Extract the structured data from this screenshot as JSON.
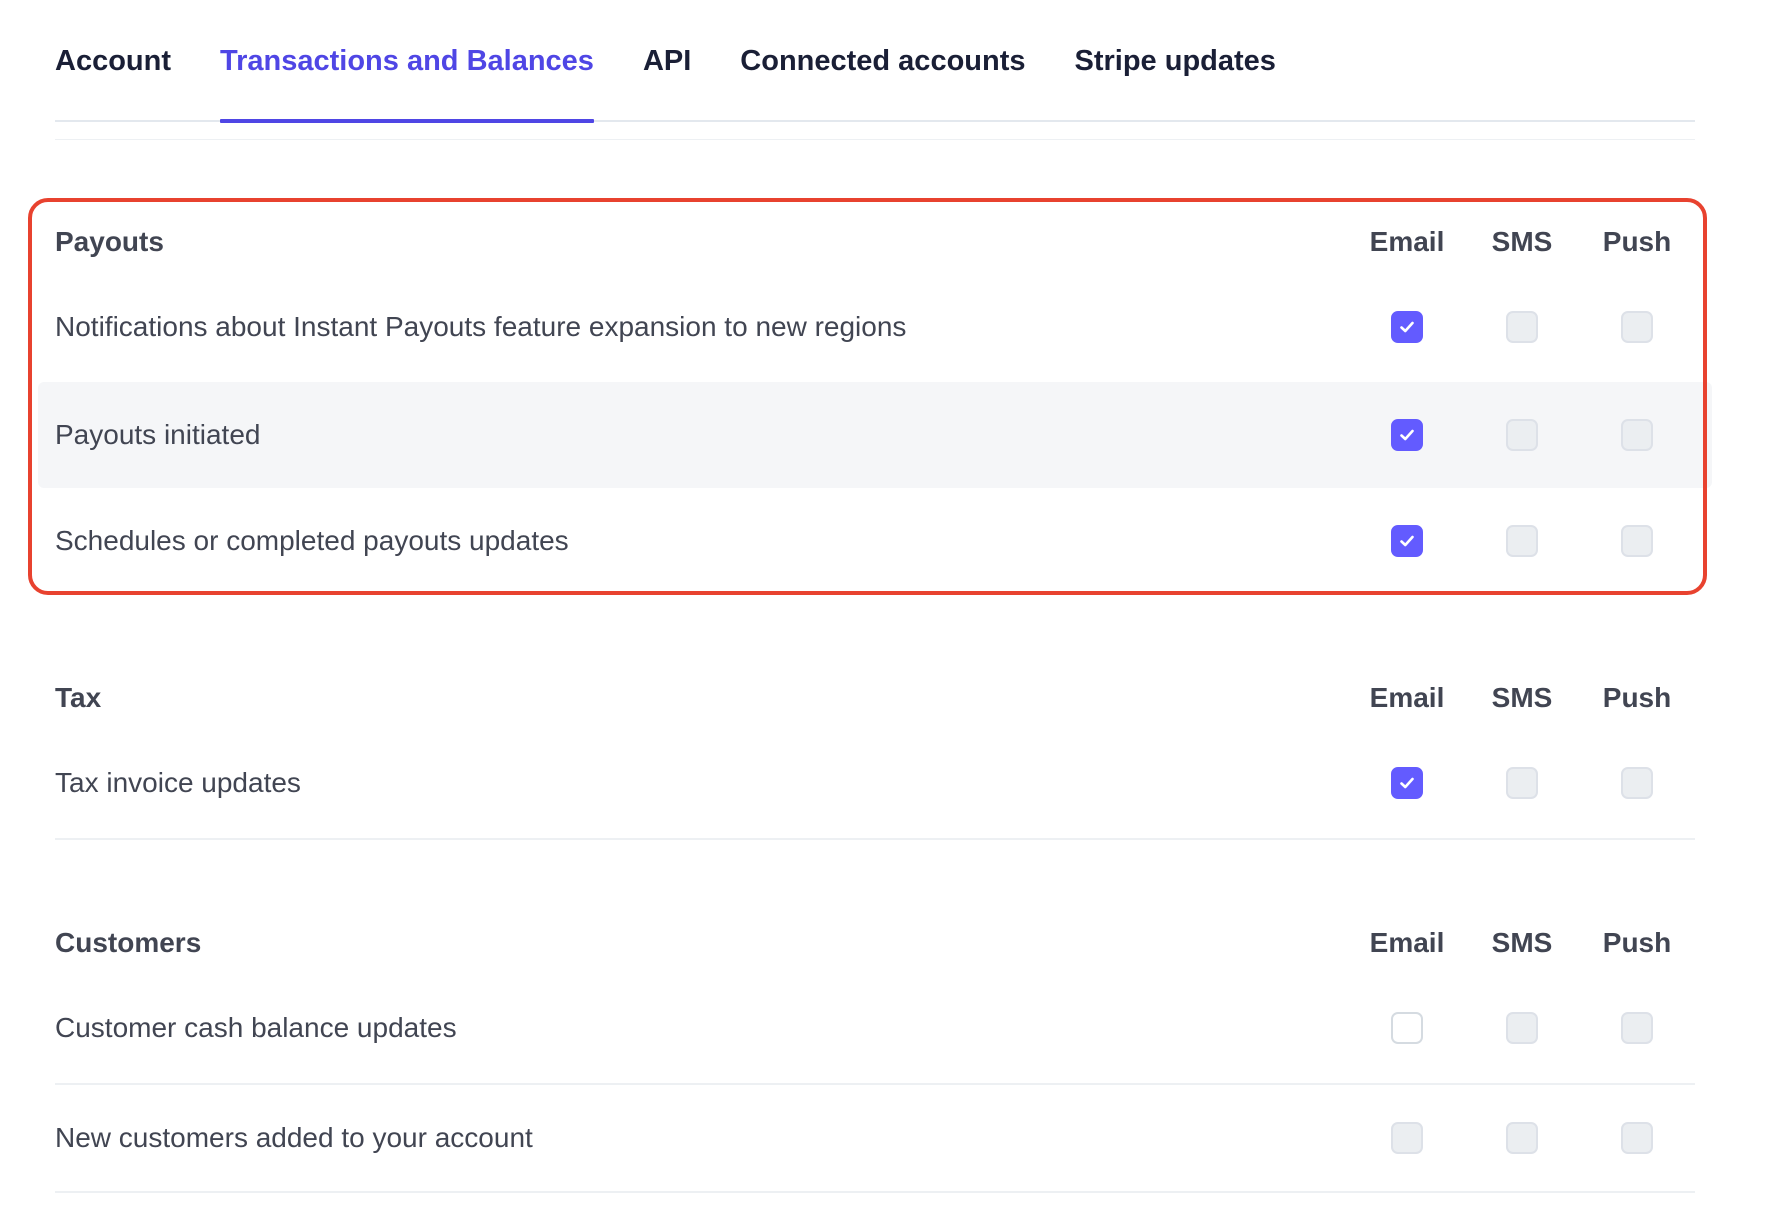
{
  "tabs": [
    {
      "label": "Account",
      "active": false
    },
    {
      "label": "Transactions and Balances",
      "active": true
    },
    {
      "label": "API",
      "active": false
    },
    {
      "label": "Connected accounts",
      "active": false
    },
    {
      "label": "Stripe updates",
      "active": false
    }
  ],
  "columns": {
    "email": "Email",
    "sms": "SMS",
    "push": "Push"
  },
  "sections": {
    "payouts": {
      "title": "Payouts",
      "rows": [
        {
          "label": "Notifications about Instant Payouts feature expansion to new regions",
          "email": true,
          "sms": false,
          "push": false
        },
        {
          "label": "Payouts initiated",
          "email": true,
          "sms": false,
          "push": false
        },
        {
          "label": "Schedules or completed payouts updates",
          "email": true,
          "sms": false,
          "push": false
        }
      ]
    },
    "tax": {
      "title": "Tax",
      "rows": [
        {
          "label": "Tax invoice updates",
          "email": true,
          "sms": false,
          "push": false
        }
      ]
    },
    "customers": {
      "title": "Customers",
      "rows": [
        {
          "label": "Customer cash balance updates",
          "email": false,
          "sms": false,
          "push": false
        },
        {
          "label": "New customers added to your account",
          "email": false,
          "sms": false,
          "push": false
        }
      ]
    }
  },
  "colors": {
    "accent": "#635bff",
    "active_tab": "#4f46e5",
    "highlight_border": "#e8422f"
  }
}
